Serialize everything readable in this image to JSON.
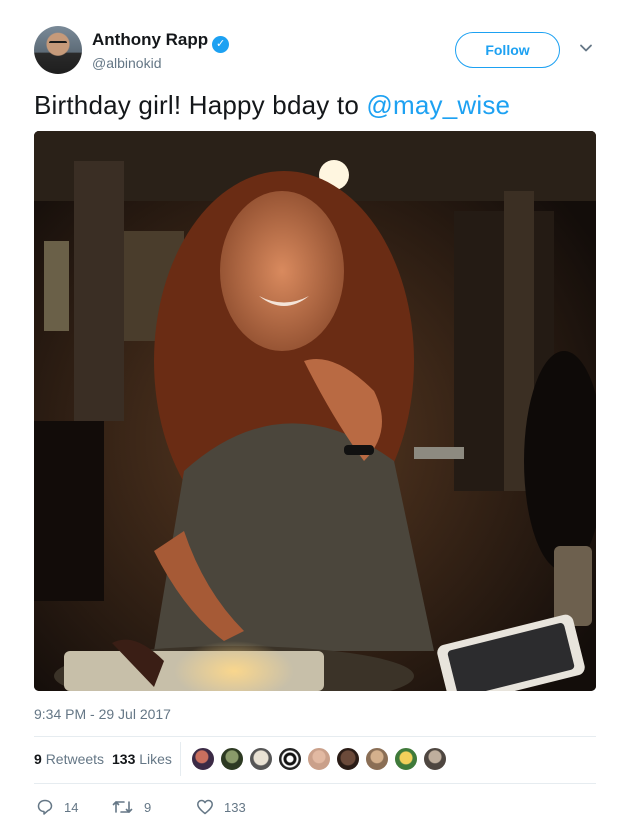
{
  "author": {
    "name": "Anthony Rapp",
    "handle": "@albinokid",
    "verified_icon": "verified-badge-icon"
  },
  "follow_label": "Follow",
  "tweet": {
    "text": "Birthday girl! Happy bday to ",
    "mention": "@may_wise"
  },
  "timestamp": "9:34 PM - 29 Jul 2017",
  "stats": {
    "retweets_count": "9",
    "retweets_label": "Retweets",
    "likes_count": "133",
    "likes_label": "Likes"
  },
  "actions": {
    "reply_count": "14",
    "retweet_count": "9",
    "like_count": "133"
  },
  "colors": {
    "accent": "#1da1f2",
    "secondary_text": "#657786"
  }
}
